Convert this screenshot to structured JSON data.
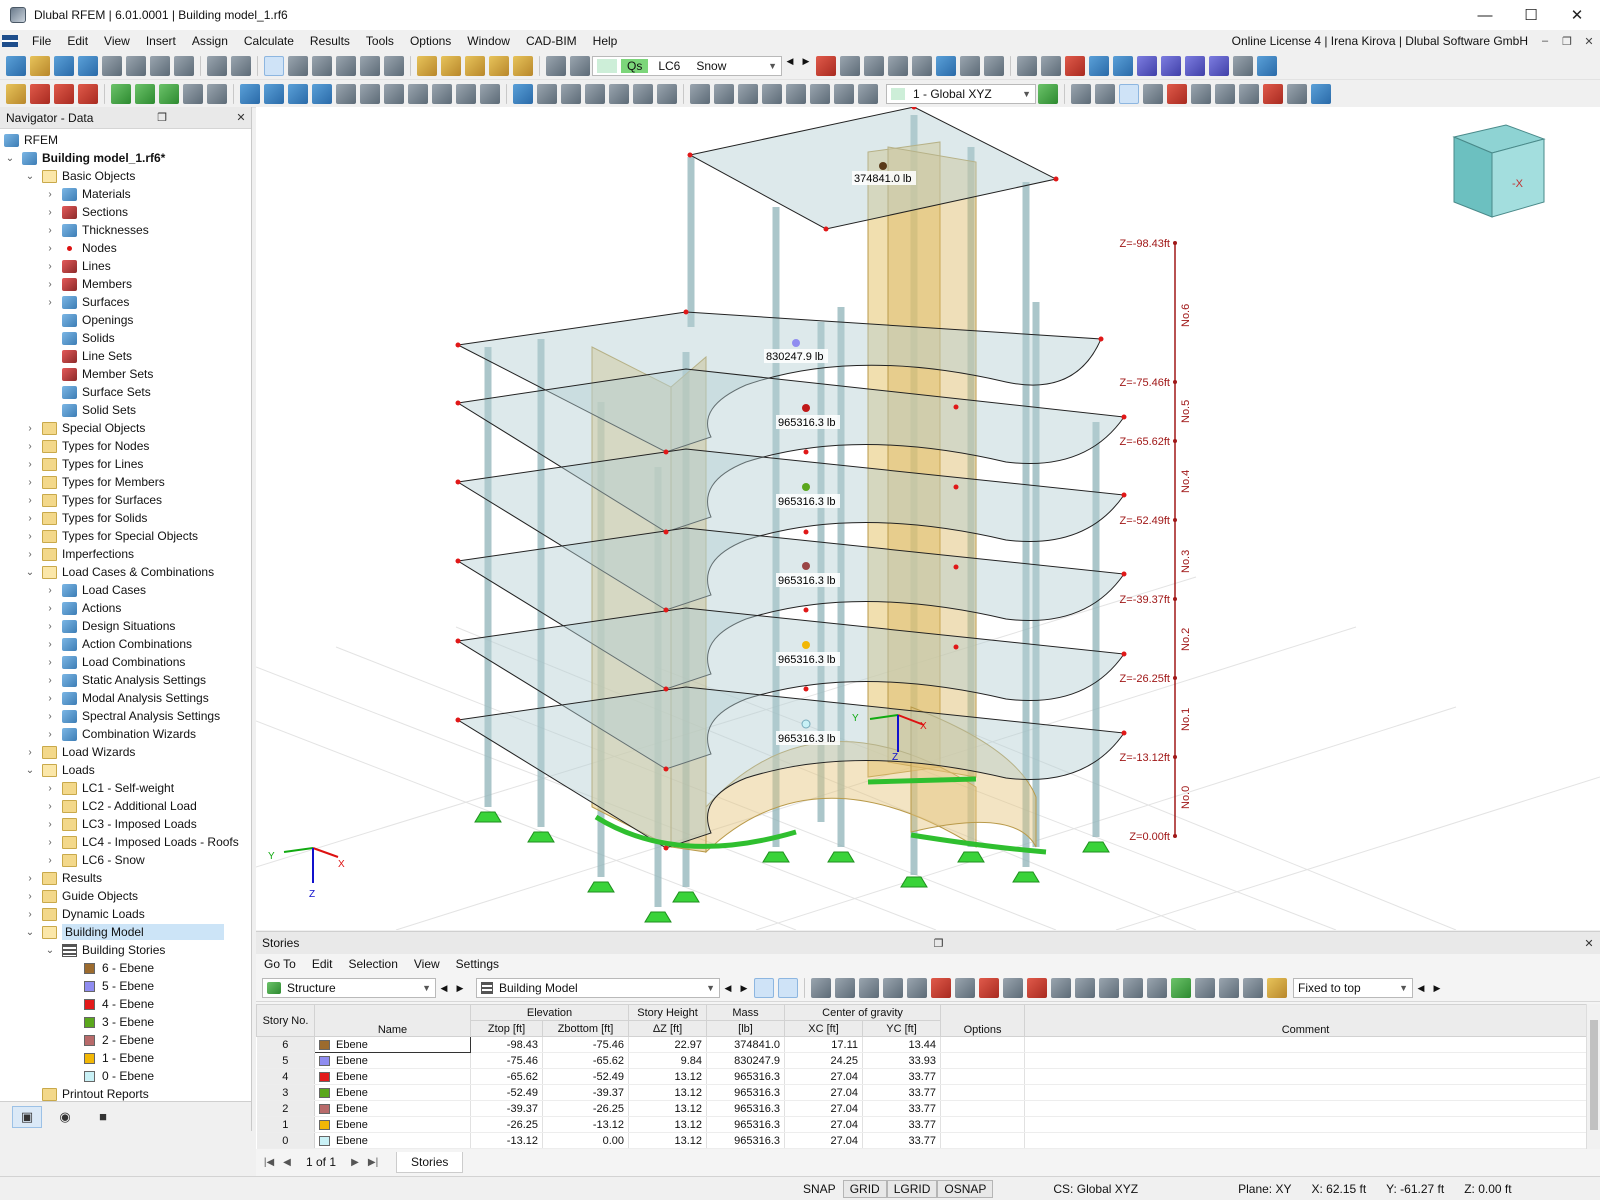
{
  "window": {
    "title": "Dlubal RFEM | 6.01.0001 | Building model_1.rf6",
    "minimize": "—",
    "maximize": "☐",
    "close": "✕"
  },
  "menu": {
    "items": [
      "File",
      "Edit",
      "View",
      "Insert",
      "Assign",
      "Calculate",
      "Results",
      "Tools",
      "Options",
      "Window",
      "CAD-BIM",
      "Help"
    ],
    "license": "Online License 4 | Irena Kirova | Dlubal Software GmbH"
  },
  "toolbar": {
    "lc_badge": "Qs",
    "lc_id": "LC6",
    "lc_name": "Snow",
    "view_select": "1 - Global XYZ"
  },
  "navigator": {
    "title": "Navigator - Data",
    "root": "RFEM",
    "model": "Building model_1.rf6*",
    "basic_objects": "Basic Objects",
    "basic_items": [
      "Materials",
      "Sections",
      "Thicknesses",
      "Nodes",
      "Lines",
      "Members",
      "Surfaces",
      "Openings",
      "Solids",
      "Line Sets",
      "Member Sets",
      "Surface Sets",
      "Solid Sets"
    ],
    "types": [
      "Special Objects",
      "Types for Nodes",
      "Types for Lines",
      "Types for Members",
      "Types for Surfaces",
      "Types for Solids",
      "Types for Special Objects",
      "Imperfections"
    ],
    "lcc": "Load Cases & Combinations",
    "lcc_items": [
      "Load Cases",
      "Actions",
      "Design Situations",
      "Action Combinations",
      "Load Combinations",
      "Static Analysis Settings",
      "Modal Analysis Settings",
      "Spectral Analysis Settings",
      "Combination Wizards"
    ],
    "load_wizards": "Load Wizards",
    "loads": "Loads",
    "load_items": [
      "LC1 - Self-weight",
      "LC2 - Additional Load",
      "LC3 - Imposed Loads",
      "LC4 - Imposed Loads - Roofs",
      "LC6 - Snow"
    ],
    "results": "Results",
    "guide": "Guide Objects",
    "dynamic": "Dynamic Loads",
    "building_model": "Building Model",
    "building_stories": "Building Stories",
    "story_items": [
      {
        "label": "6 - Ebene",
        "color": "#9c6b2e"
      },
      {
        "label": "5 - Ebene",
        "color": "#8f8cf0"
      },
      {
        "label": "4 - Ebene",
        "color": "#e31a1a"
      },
      {
        "label": "3 - Ebene",
        "color": "#5aa71c"
      },
      {
        "label": "2 - Ebene",
        "color": "#b86a6a"
      },
      {
        "label": "1 - Ebene",
        "color": "#f2b705"
      },
      {
        "label": "0 - Ebene",
        "color": "#c9f1f6"
      }
    ],
    "printout": "Printout Reports"
  },
  "viewport": {
    "story_labels": [
      "No.6",
      "No.5",
      "No.4",
      "No.3",
      "No.2",
      "No.1",
      "No.0"
    ],
    "elevations": [
      "Z=-98.43ft",
      "Z=-75.46ft",
      "Z=-65.62ft",
      "Z=-52.49ft",
      "Z=-39.37ft",
      "Z=-26.25ft",
      "Z=-13.12ft",
      "Z=0.00ft"
    ],
    "mass_labels": [
      "374841.0 lb",
      "830247.9 lb",
      "965316.3 lb",
      "965316.3 lb",
      "965316.3 lb",
      "965316.3 lb",
      "965316.3 lb"
    ],
    "axes": {
      "x": "X",
      "y": "Y",
      "z": "Z"
    },
    "cube_label": "-X"
  },
  "stories": {
    "title": "Stories",
    "menu": [
      "Go To",
      "Edit",
      "Selection",
      "View",
      "Settings"
    ],
    "structure_select": "Structure",
    "model_select": "Building Model",
    "fixed_select": "Fixed to top",
    "headers": {
      "story_no": "Story No.",
      "name": "Name",
      "elevation": "Elevation",
      "ztop": "Ztop [ft]",
      "zbottom": "Zbottom [ft]",
      "story_height": "Story Height",
      "dz": "ΔZ [ft]",
      "mass": "Mass",
      "mass_unit": "[lb]",
      "cog": "Center of gravity",
      "xc": "XC [ft]",
      "yc": "YC [ft]",
      "options": "Options",
      "comment": "Comment"
    },
    "rows": [
      {
        "no": "6",
        "name": "Ebene",
        "color": "#9c6b2e",
        "ztop": "-98.43",
        "zbot": "-75.46",
        "dz": "22.97",
        "mass": "374841.0",
        "xc": "17.11",
        "yc": "13.44"
      },
      {
        "no": "5",
        "name": "Ebene",
        "color": "#8f8cf0",
        "ztop": "-75.46",
        "zbot": "-65.62",
        "dz": "9.84",
        "mass": "830247.9",
        "xc": "24.25",
        "yc": "33.93"
      },
      {
        "no": "4",
        "name": "Ebene",
        "color": "#e31a1a",
        "ztop": "-65.62",
        "zbot": "-52.49",
        "dz": "13.12",
        "mass": "965316.3",
        "xc": "27.04",
        "yc": "33.77"
      },
      {
        "no": "3",
        "name": "Ebene",
        "color": "#5aa71c",
        "ztop": "-52.49",
        "zbot": "-39.37",
        "dz": "13.12",
        "mass": "965316.3",
        "xc": "27.04",
        "yc": "33.77"
      },
      {
        "no": "2",
        "name": "Ebene",
        "color": "#b86a6a",
        "ztop": "-39.37",
        "zbot": "-26.25",
        "dz": "13.12",
        "mass": "965316.3",
        "xc": "27.04",
        "yc": "33.77"
      },
      {
        "no": "1",
        "name": "Ebene",
        "color": "#f2b705",
        "ztop": "-26.25",
        "zbot": "-13.12",
        "dz": "13.12",
        "mass": "965316.3",
        "xc": "27.04",
        "yc": "33.77"
      },
      {
        "no": "0",
        "name": "Ebene",
        "color": "#c9f1f6",
        "ztop": "-13.12",
        "zbot": "0.00",
        "dz": "13.12",
        "mass": "965316.3",
        "xc": "27.04",
        "yc": "33.77"
      }
    ],
    "page": "1 of 1",
    "tab": "Stories"
  },
  "statusbar": {
    "snap": "SNAP",
    "grid": "GRID",
    "lgrid": "LGRID",
    "osnap": "OSNAP",
    "cs": "CS: Global XYZ",
    "plane": "Plane: XY",
    "x": "X: 62.15 ft",
    "y": "Y: -61.27 ft",
    "z": "Z: 0.00 ft"
  }
}
